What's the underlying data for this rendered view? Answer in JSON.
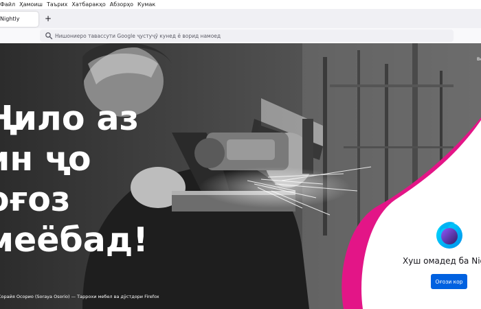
{
  "menu": [
    "Файл",
    "Ҳамоиш",
    "Таърих",
    "Хатбаракҳо",
    "Абзорҳо",
    "Кумак"
  ],
  "tab": {
    "title": "Nightly",
    "new_tab_symbol": "+"
  },
  "address_bar": {
    "placeholder": "Нишониеро тавассути Google ҷустуҷӯ кунед ё ворид намоед"
  },
  "hero": {
    "headline_lines": [
      "Ҷило аз",
      "ин ҷо",
      "оғоз",
      "меёбад!"
    ],
    "caption": "Сорайя Осорио (Soraya Osorio) — Таррохи мебел ва дӯстдори Firefox",
    "corner_text": "Be"
  },
  "welcome_panel": {
    "title": "Хуш омадед ба Nightly",
    "button_label": "Оғози кор"
  },
  "colors": {
    "button": "#0061e0",
    "accent_pink": "#e31587",
    "accent_orange": "#ff7139"
  }
}
